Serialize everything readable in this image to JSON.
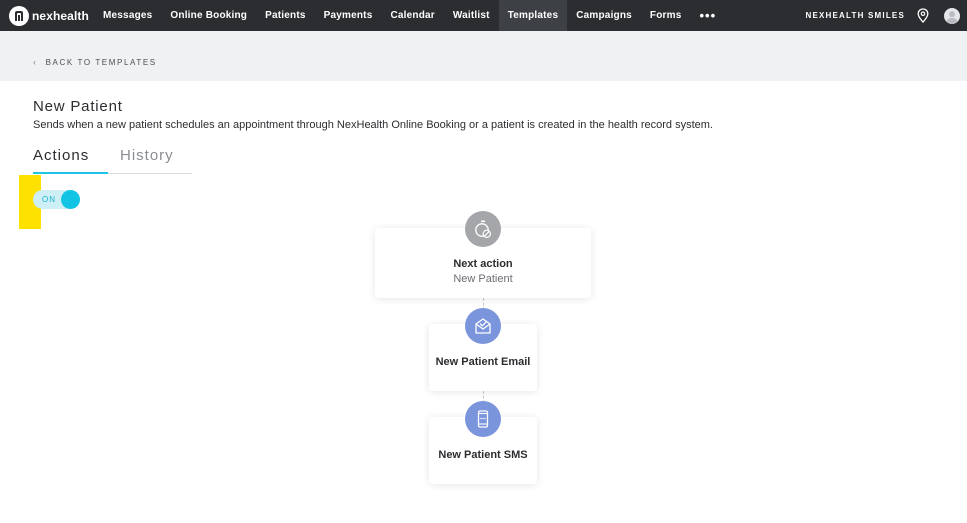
{
  "app": {
    "logo_text": "nexhealth"
  },
  "nav": {
    "items": [
      {
        "label": "Messages",
        "active": false
      },
      {
        "label": "Online Booking",
        "active": false
      },
      {
        "label": "Patients",
        "active": false
      },
      {
        "label": "Payments",
        "active": false
      },
      {
        "label": "Calendar",
        "active": false
      },
      {
        "label": "Waitlist",
        "active": false
      },
      {
        "label": "Templates",
        "active": true
      },
      {
        "label": "Campaigns",
        "active": false
      },
      {
        "label": "Forms",
        "active": false
      }
    ],
    "more_label": "•••",
    "org_name": "NEXHEALTH SMILES"
  },
  "breadcrumb": {
    "back_label": "BACK TO TEMPLATES"
  },
  "page": {
    "title": "New Patient",
    "description": "Sends when a new patient schedules an appointment through NexHealth Online Booking or a patient is created in the health record system."
  },
  "tabs": [
    {
      "label": "Actions",
      "active": true
    },
    {
      "label": "History",
      "active": false
    }
  ],
  "toggle": {
    "label": "ON",
    "state": "on"
  },
  "workflow": {
    "nodes": [
      {
        "title": "Next action",
        "subtitle": "New Patient",
        "icon": "timer-off-icon",
        "icon_color": "#a4a6a9"
      },
      {
        "title": "New Patient Email",
        "icon": "email-icon",
        "icon_color": "#7b95dc"
      },
      {
        "title": "New Patient SMS",
        "icon": "phone-icon",
        "icon_color": "#7b95dc"
      }
    ]
  },
  "colors": {
    "nav_bg": "#2b2d30",
    "accent": "#11c4e3",
    "highlight": "#ffe100"
  }
}
